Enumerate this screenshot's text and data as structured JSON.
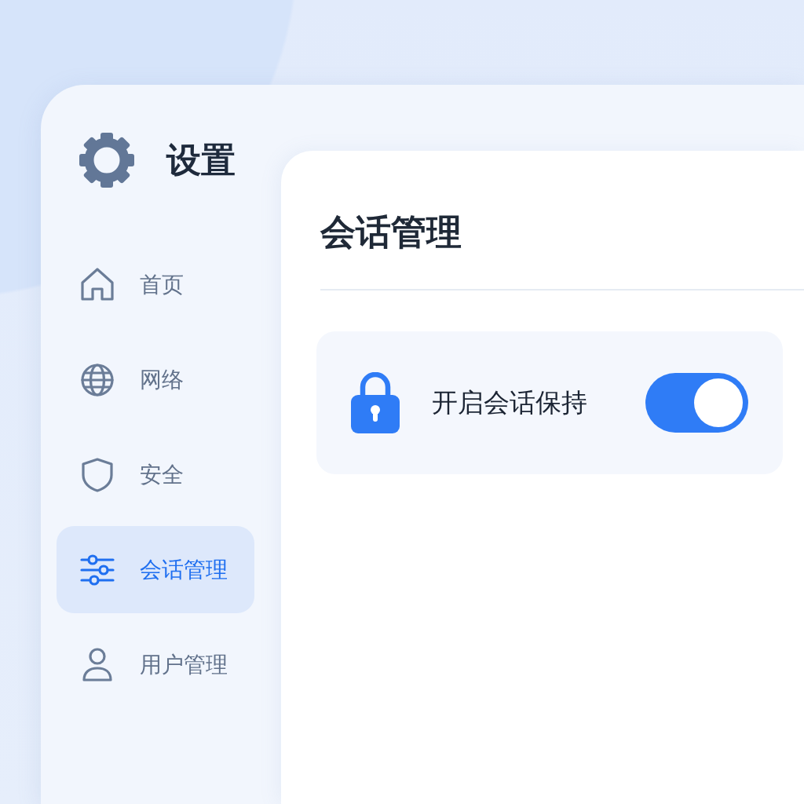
{
  "sidebar": {
    "title": "设置",
    "items": [
      {
        "label": "首页",
        "selected": false
      },
      {
        "label": "网络",
        "selected": false
      },
      {
        "label": "安全",
        "selected": false
      },
      {
        "label": "会话管理",
        "selected": true
      },
      {
        "label": "用户管理",
        "selected": false
      }
    ]
  },
  "content": {
    "title": "会话管理",
    "settings": [
      {
        "label": "开启会话保持",
        "on": true
      }
    ]
  }
}
